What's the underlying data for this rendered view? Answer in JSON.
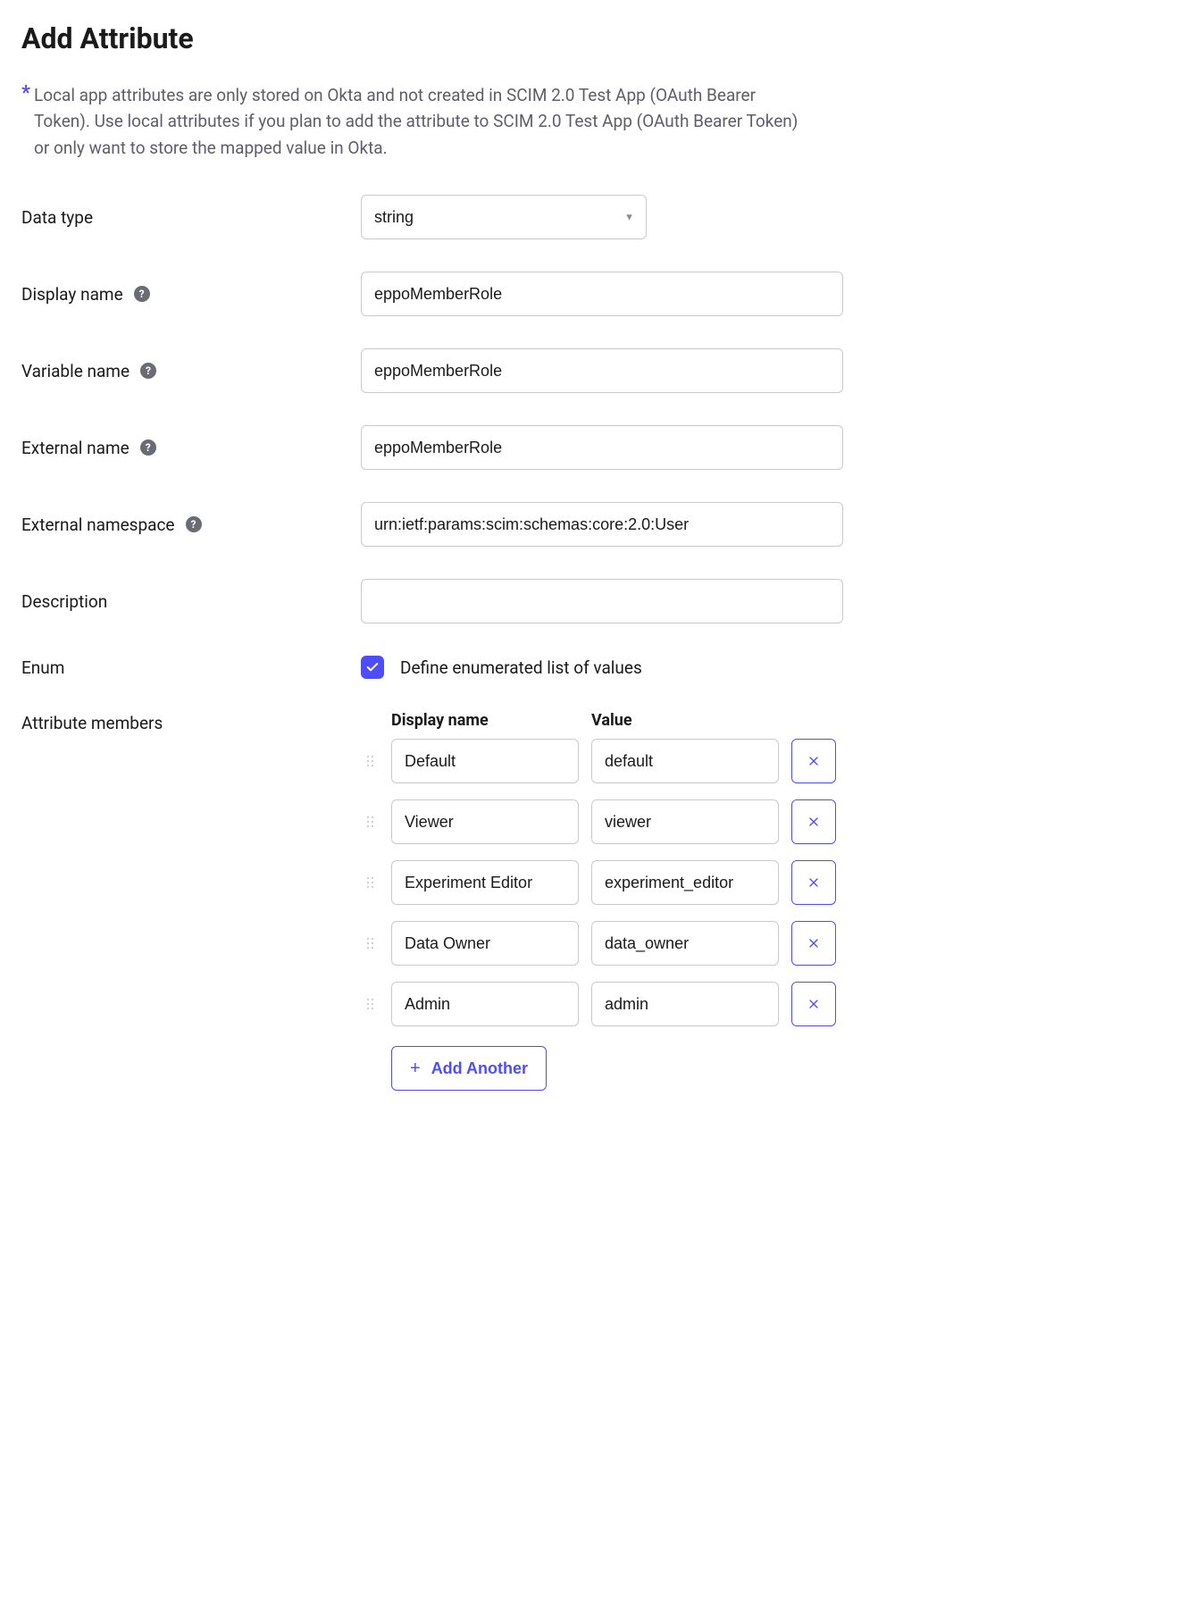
{
  "title": "Add Attribute",
  "info_text": "Local app attributes are only stored on Okta and not created in SCIM 2.0 Test App (OAuth Bearer Token). Use local attributes if you plan to add the attribute to SCIM 2.0 Test App (OAuth Bearer Token) or only want to store the mapped value in Okta.",
  "labels": {
    "data_type": "Data type",
    "display_name": "Display name",
    "variable_name": "Variable name",
    "external_name": "External name",
    "external_namespace": "External namespace",
    "description": "Description",
    "enum": "Enum",
    "attribute_members": "Attribute members"
  },
  "values": {
    "data_type": "string",
    "display_name": "eppoMemberRole",
    "variable_name": "eppoMemberRole",
    "external_name": "eppoMemberRole",
    "external_namespace": "urn:ietf:params:scim:schemas:core:2.0:User",
    "description": ""
  },
  "enum_checkbox_label": "Define enumerated list of values",
  "enum_checked": true,
  "members_headers": {
    "display_name": "Display name",
    "value": "Value"
  },
  "members": [
    {
      "display": "Default",
      "value": "default"
    },
    {
      "display": "Viewer",
      "value": "viewer"
    },
    {
      "display": "Experiment Editor",
      "value": "experiment_editor"
    },
    {
      "display": "Data Owner",
      "value": "data_owner"
    },
    {
      "display": "Admin",
      "value": "admin"
    }
  ],
  "add_another_label": "Add Another",
  "icons": {
    "help": "?",
    "asterisk": "*"
  }
}
